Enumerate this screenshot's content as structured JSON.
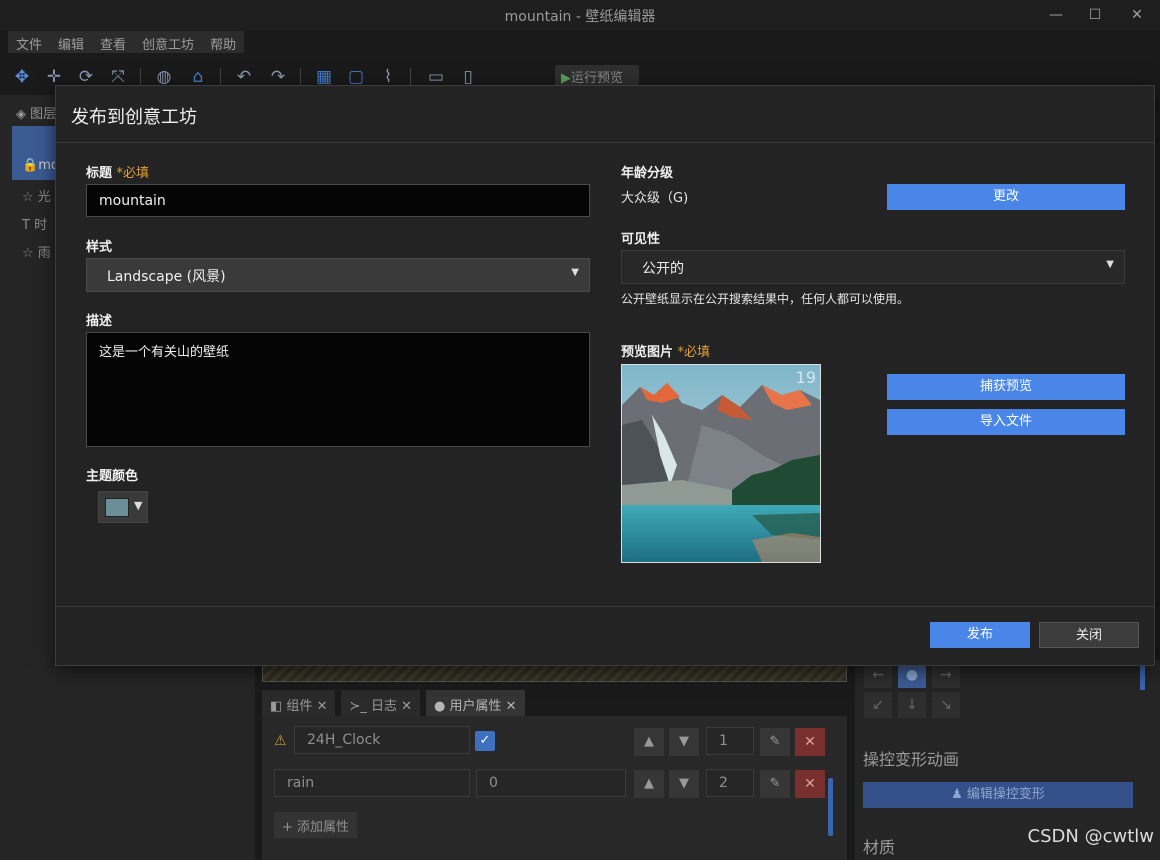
{
  "window": {
    "title": "mountain - 壁纸编辑器",
    "controls": {
      "minimize": "—",
      "maximize": "☐",
      "close": "✕"
    }
  },
  "menu": [
    "文件",
    "编辑",
    "查看",
    "创意工坊",
    "帮助"
  ],
  "toolbar": {
    "run_preview": "运行预览"
  },
  "left_panel": {
    "header": "图层",
    "items": [
      "mo",
      "光",
      "时",
      "雨"
    ]
  },
  "bottom_panel": {
    "tabs": [
      {
        "label": "组件",
        "icon": "puzzle-icon"
      },
      {
        "label": "日志",
        "icon": "terminal-icon"
      },
      {
        "label": "用户属性",
        "icon": "user-icon"
      }
    ],
    "properties": [
      {
        "name": "24H_Clock",
        "index": "1",
        "checked": true
      },
      {
        "name": "rain",
        "value": "0",
        "index": "2"
      }
    ],
    "add_property": "添加属性"
  },
  "right_panel": {
    "section_title": "操控变形动画",
    "edit_button": "编辑操控变形",
    "material_title": "材质"
  },
  "watermark": "CSDN @cwtlw",
  "dialog": {
    "title": "发布到创意工坊",
    "title_label": "标题",
    "required_mark": "*必填",
    "title_value": "mountain",
    "style_label": "样式",
    "style_value": "Landscape (风景)",
    "description_label": "描述",
    "description_value": "这是一个有关山的壁纸",
    "theme_color_label": "主题颜色",
    "theme_color": "#6b8f99",
    "age_rating_label": "年龄分级",
    "age_rating_value": "大众级（G)",
    "change_button": "更改",
    "visibility_label": "可见性",
    "visibility_value": "公开的",
    "visibility_hint": "公开壁纸显示在公开搜索结果中，任何人都可以使用。",
    "preview_label": "预览图片",
    "preview_badge": "19",
    "capture_button": "捕获预览",
    "import_button": "导入文件",
    "publish_button": "发布",
    "close_button": "关闭"
  }
}
